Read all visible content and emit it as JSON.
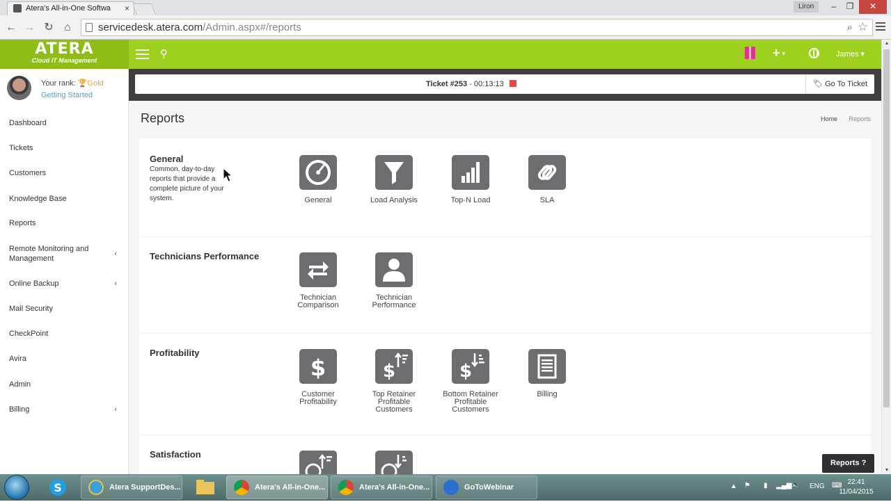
{
  "browser": {
    "tab_title": "Atera's All-in-One Softwa",
    "user_name": "Liron",
    "url_domain": "servicedesk.atera.com",
    "url_path": "/Admin.aspx#/reports"
  },
  "header": {
    "logo_brand": "ATERA",
    "logo_tagline": "Cloud IT Management",
    "user_menu": "James"
  },
  "sidebar": {
    "rank_label": "Your rank:",
    "rank_value": "Gold",
    "getting_started": "Getting Started",
    "items": [
      {
        "label": "Dashboard"
      },
      {
        "label": "Tickets"
      },
      {
        "label": "Customers"
      },
      {
        "label": "Knowledge Base"
      },
      {
        "label": "Reports"
      },
      {
        "label": "Remote Monitoring and Management"
      },
      {
        "label": "Online Backup"
      },
      {
        "label": "Mail Security"
      },
      {
        "label": "CheckPoint"
      },
      {
        "label": "Avira"
      },
      {
        "label": "Admin"
      },
      {
        "label": "Billing"
      }
    ]
  },
  "ticket_bar": {
    "ticket_number": "Ticket #253",
    "separator": "-",
    "timer": "00:13:13",
    "goto_label": "Go To Ticket"
  },
  "page": {
    "title": "Reports",
    "breadcrumb_home": "Home",
    "breadcrumb_current": "Reports"
  },
  "sections": [
    {
      "title": "General",
      "description": "Common, day-to-day reports that provide a complete picture of your system.",
      "reports": [
        {
          "label": "General",
          "icon": "gauge-icon"
        },
        {
          "label": "Load Analysis",
          "icon": "funnel-icon"
        },
        {
          "label": "Top-N Load",
          "icon": "bar-chart-icon"
        },
        {
          "label": "SLA",
          "icon": "link-icon"
        }
      ]
    },
    {
      "title": "Technicians Performance",
      "reports": [
        {
          "label": "Technician Comparison",
          "icon": "exchange-arrows-icon"
        },
        {
          "label": "Technician Performance",
          "icon": "user-icon"
        }
      ]
    },
    {
      "title": "Profitability",
      "reports": [
        {
          "label": "Customer Profitability",
          "icon": "dollar-icon"
        },
        {
          "label": "Top Retainer Profitable Customers",
          "icon": "dollar-sort-desc-icon"
        },
        {
          "label": "Bottom Retainer Profitable Customers",
          "icon": "dollar-sort-asc-icon"
        },
        {
          "label": "Billing",
          "icon": "invoice-list-icon"
        }
      ]
    },
    {
      "title": "Satisfaction",
      "reports": [
        {
          "label": "",
          "icon": "smiley-sort-desc-icon"
        },
        {
          "label": "",
          "icon": "smiley-sort-asc-icon"
        }
      ]
    }
  ],
  "help_button": {
    "label": "Reports",
    "glyph": "?"
  },
  "taskbar": {
    "buttons": [
      {
        "label": "Atera SupportDes..."
      },
      {
        "label": "Atera's All-in-One..."
      },
      {
        "label": "Atera's All-in-One..."
      },
      {
        "label": "GoToWebinar"
      }
    ],
    "language": "ENG",
    "time": "22:41",
    "date": "11/04/2015"
  },
  "colors": {
    "header_green": "#9ed020",
    "logo_green": "#8dbd16",
    "tile_gray": "#6b6d70",
    "rank_gold": "#e2a830",
    "link_blue": "#5b9bb5",
    "stop_red": "#e2474c",
    "ticket_bar_dark": "#3d3f42"
  }
}
